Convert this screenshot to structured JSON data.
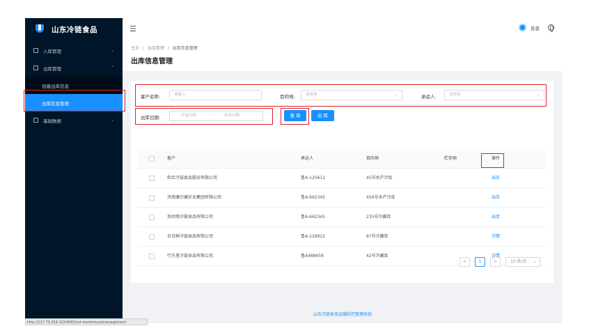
{
  "app": {
    "title": "山东冷链食品"
  },
  "sidebar": {
    "menu": [
      {
        "label": "入库管理",
        "expanded": false
      },
      {
        "label": "出库管理",
        "expanded": true,
        "children": [
          {
            "label": "创建出库信息",
            "active": false
          },
          {
            "label": "出库信息管理",
            "active": true
          }
        ]
      },
      {
        "label": "基础数据",
        "expanded": false
      }
    ],
    "status_url": "http://117.73.254.1224093/out-warehouse/management"
  },
  "header": {
    "user_name": "普普"
  },
  "breadcrumb": [
    "主页",
    "出库管理",
    "出库信息管理"
  ],
  "page_title": "出库信息管理",
  "search": {
    "customer_label": "客户名称:",
    "customer_placeholder": "请输入",
    "destination_label": "目的地:",
    "destination_placeholder": "请选择",
    "carrier_label": "承运人:",
    "carrier_placeholder": "请选择",
    "date_label": "出库日期:",
    "start_placeholder": "开始日期",
    "range_sep": "~",
    "end_placeholder": "结束日期",
    "query_button": "查 询",
    "export_button": "出 库"
  },
  "table": {
    "columns": [
      "客户",
      "承运人",
      "目的地",
      "贮存地",
      "操作"
    ],
    "rows": [
      {
        "customer": "和合冷链食品股份有限公司",
        "carrier": "鲁A-125612",
        "destination": "45号水产冷库",
        "storage": "",
        "action": "出库",
        "highlighted": true
      },
      {
        "customer": "济南康尔康实业集团有限公司",
        "carrier": "鲁A-662345",
        "destination": "456号水产冷库",
        "storage": "",
        "action": "出库",
        "highlighted": false
      },
      {
        "customer": "及时雨冷链食品有限公司",
        "carrier": "鲁A-662345",
        "destination": "235号冷藏库",
        "storage": "",
        "action": "出库",
        "highlighted": false
      },
      {
        "customer": "日日鲜冷链食品有限公司",
        "carrier": "鲁A-128922",
        "destination": "87号冷藏库",
        "storage": "",
        "action": "详情",
        "highlighted": false
      },
      {
        "customer": "行万里冷链食品有限公司",
        "carrier": "鲁A488656",
        "destination": "42号冷藏库",
        "storage": "",
        "action": "详情",
        "highlighted": false
      }
    ]
  },
  "pagination": {
    "prev": "<",
    "current": "1",
    "next": ">",
    "page_size": "10 条/页"
  },
  "footer": "山东冷链食品运输防控管理系统",
  "colors": {
    "sidebar_bg": "#001529",
    "primary": "#1890ff",
    "annotation_red": "#e02020"
  }
}
